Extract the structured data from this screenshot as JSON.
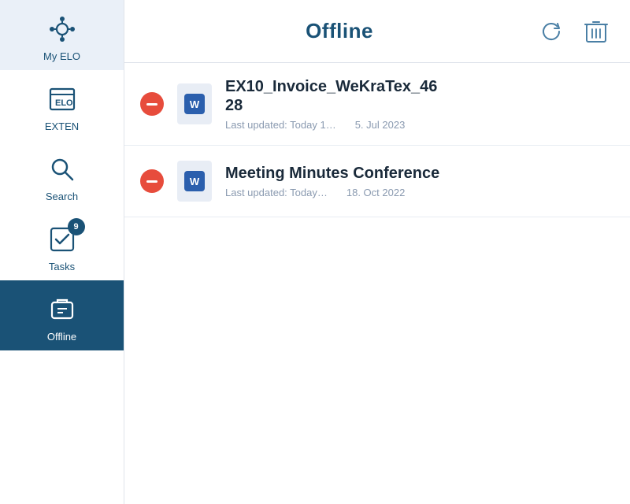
{
  "sidebar": {
    "items": [
      {
        "id": "my-elo",
        "label": "My ELO",
        "active": false,
        "badge": null
      },
      {
        "id": "exten",
        "label": "EXTEN",
        "active": false,
        "badge": null
      },
      {
        "id": "search",
        "label": "Search",
        "active": false,
        "badge": null
      },
      {
        "id": "tasks",
        "label": "Tasks",
        "active": false,
        "badge": 9
      },
      {
        "id": "offline",
        "label": "Offline",
        "active": true,
        "badge": null
      }
    ]
  },
  "topbar": {
    "title": "Offline",
    "refresh_label": "Refresh",
    "delete_label": "Delete"
  },
  "files": [
    {
      "id": "file-1",
      "name": "EX10_Invoice_WeKraTex_46\n28",
      "name_line1": "EX10_Invoice_WeKraTex_46",
      "name_line2": "28",
      "last_updated": "Last updated: Today 1…",
      "date": "5. Jul 2023",
      "type": "word"
    },
    {
      "id": "file-2",
      "name": "Meeting Minutes Conference",
      "name_line1": "Meeting Minutes Conference",
      "name_line2": "",
      "last_updated": "Last updated: Today…",
      "date": "18. Oct 2022",
      "type": "word"
    }
  ],
  "icons": {
    "word_label": "W"
  }
}
